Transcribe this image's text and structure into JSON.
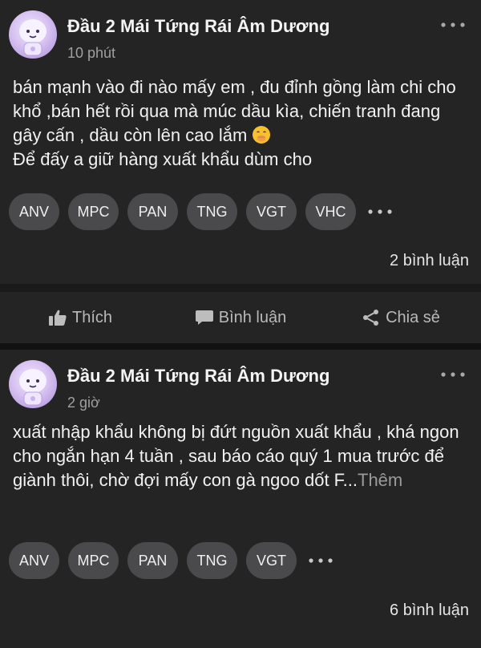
{
  "posts": [
    {
      "author": "Đầu 2 Mái Tứng Rái Âm Dương",
      "time": "10 phút",
      "content_line": "bán mạnh vào đi nào mấy em , đu đỉnh gồng làm chi cho khổ ,bán hết rồi qua mà múc dầu kìa, chiến tranh đang gây cấn , dầu còn lên cao lắm",
      "content_line2": "Để đấy a giữ hàng xuất khẩu dùm cho",
      "tags": [
        "ANV",
        "MPC",
        "PAN",
        "TNG",
        "VGT",
        "VHC"
      ],
      "comments": "2 bình luận",
      "actions": {
        "like": "Thích",
        "comment": "Bình luận",
        "share": "Chia sẻ"
      }
    },
    {
      "author": "Đầu 2 Mái Tứng Rái Âm Dương",
      "time": "2 giờ",
      "content_line": "xuất nhập khẩu không bị đứt nguồn xuất khẩu , khá ngon cho ngắn hạn 4 tuần , sau báo cáo quý 1 mua trước để giành thôi, chờ đợi mấy con gà ngoo dốt F...",
      "see_more": "Thêm",
      "tags": [
        "ANV",
        "MPC",
        "PAN",
        "TNG",
        "VGT"
      ],
      "comments": "6 bình luận"
    }
  ],
  "icons": {
    "more": "ellipsis-icon",
    "like": "thumbs-up-icon",
    "comment": "speech-bubble-icon",
    "share": "share-icon",
    "emoji": "face-with-hand-over-mouth-emoji"
  }
}
